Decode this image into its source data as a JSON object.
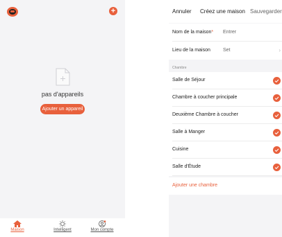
{
  "left": {
    "empty_text": "pas d'appareils",
    "add_device_label": "Ajouter un appareil",
    "add_icon": "plus-icon",
    "logo_icon": "app-logo-icon",
    "nav": [
      {
        "label": "Maison",
        "icon": "house-icon",
        "active": true
      },
      {
        "label": "Intelligent",
        "icon": "sun-icon",
        "active": false
      },
      {
        "label": "Mon compte",
        "icon": "user-icon",
        "active": false
      }
    ]
  },
  "right": {
    "header": {
      "cancel": "Annuler",
      "title": "Créez une maison",
      "save": "Sauvegarder"
    },
    "fields": {
      "name_label": "Nom de la maison",
      "name_required_mark": "*",
      "name_placeholder": "Entrer",
      "location_label": "Lieu de la maison",
      "location_value": "Set"
    },
    "section_label": "Chambre",
    "rooms": [
      {
        "label": "Salle de Séjour",
        "checked": true
      },
      {
        "label": "Chambre à coucher principale",
        "checked": true
      },
      {
        "label": "Deuxième Chambre à coucher",
        "checked": true
      },
      {
        "label": "Salle à Manger",
        "checked": true
      },
      {
        "label": "Cuisine",
        "checked": true
      },
      {
        "label": "Salle d'Étude",
        "checked": true
      }
    ],
    "add_room": "Ajouter une chambre"
  },
  "colors": {
    "accent": "#e8603c",
    "background": "#f4f4f6"
  }
}
